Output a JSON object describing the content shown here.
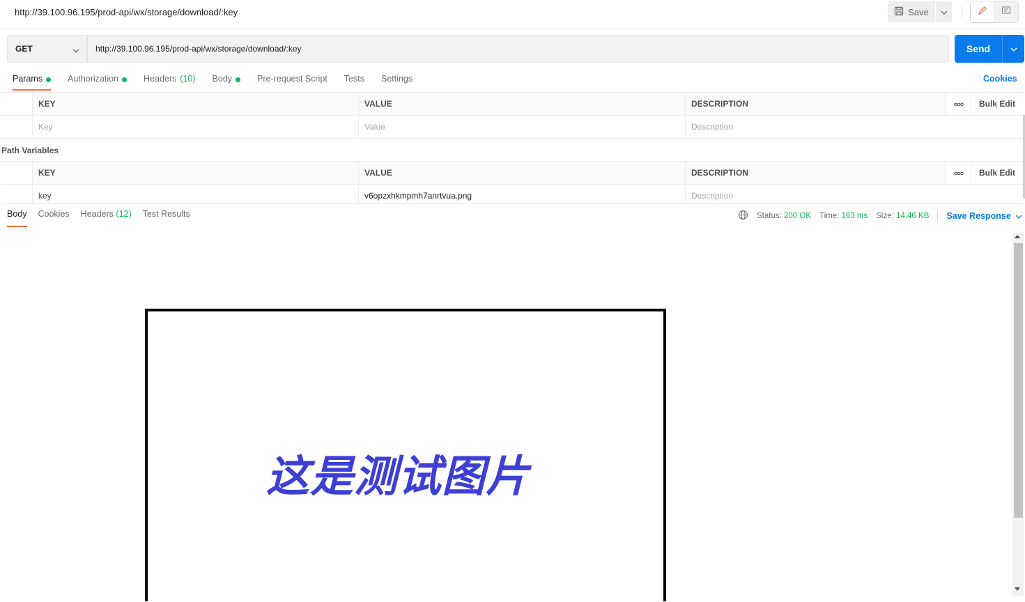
{
  "header": {
    "title": "http://39.100.96.195/prod-api/wx/storage/download/:key",
    "save_label": "Save"
  },
  "request": {
    "method": "GET",
    "url": "http://39.100.96.195/prod-api/wx/storage/download/:key",
    "send_label": "Send"
  },
  "tabs": {
    "params": "Params",
    "authorization": "Authorization",
    "headers": "Headers",
    "headers_count": "(10)",
    "body": "Body",
    "prerequest": "Pre-request Script",
    "tests": "Tests",
    "settings": "Settings",
    "cookies": "Cookies"
  },
  "params_table": {
    "col_key": "KEY",
    "col_value": "VALUE",
    "col_description": "DESCRIPTION",
    "bulk_edit": "Bulk Edit",
    "key_placeholder": "Key",
    "value_placeholder": "Value",
    "description_placeholder": "Description"
  },
  "path_variables": {
    "label": "Path Variables",
    "col_key": "KEY",
    "col_value": "VALUE",
    "col_description": "DESCRIPTION",
    "bulk_edit": "Bulk Edit",
    "rows": [
      {
        "key": "key",
        "value": "v6opzxhkmpmh7anrtvua.png",
        "description_placeholder": "Description"
      }
    ]
  },
  "response": {
    "tabs": {
      "body": "Body",
      "cookies": "Cookies",
      "headers": "Headers",
      "headers_count": "(12)",
      "test_results": "Test Results"
    },
    "status_label": "Status:",
    "status_value": "200 OK",
    "time_label": "Time:",
    "time_value": "163 ms",
    "size_label": "Size:",
    "size_value": "14.46 KB",
    "save_response": "Save Response",
    "image_text": "这是测试图片"
  },
  "colors": {
    "accent": "#097bed",
    "active_tab": "#ff6c37",
    "ok": "#0cbb52",
    "image_text": "#3e3fd4"
  }
}
